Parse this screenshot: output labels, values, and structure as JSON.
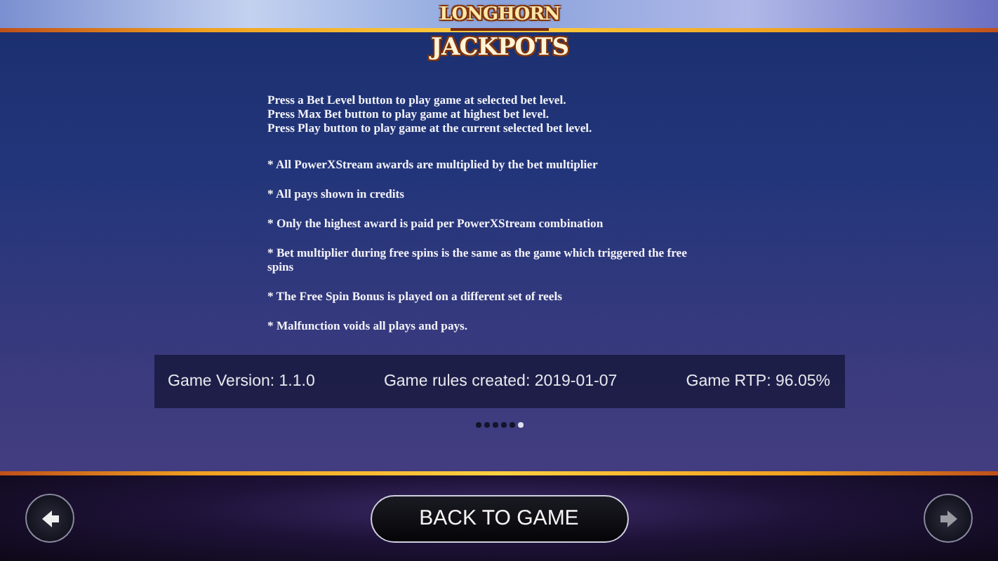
{
  "logo": {
    "line_1": "LONGHORN",
    "line_2": "JACKPOTS"
  },
  "instructions": [
    "Press a Bet Level button to play game at selected bet level.",
    "Press Max Bet button to play game at highest bet level.",
    "Press Play button to play game at the current selected bet level."
  ],
  "rules": [
    "* All PowerXStream awards are multiplied by the bet multiplier",
    "* All pays shown in credits",
    "* Only the highest award is paid per PowerXStream combination",
    "* Bet multiplier during free spins is the same as the game which triggered the free spins",
    "* The Free Spin Bonus is played on a different set of reels",
    "* Malfunction voids all plays and pays."
  ],
  "info_bar": [
    "Game Version: 1.1.0",
    "Game rules created: 2019-01-07",
    "Game RTP: 96.05%"
  ],
  "pages": [
    {
      "selected": false
    },
    {
      "selected": false
    },
    {
      "selected": false
    },
    {
      "selected": false
    },
    {
      "selected": false
    },
    {
      "selected": true
    }
  ],
  "footer": {
    "back_button": "BACK TO GAME"
  }
}
